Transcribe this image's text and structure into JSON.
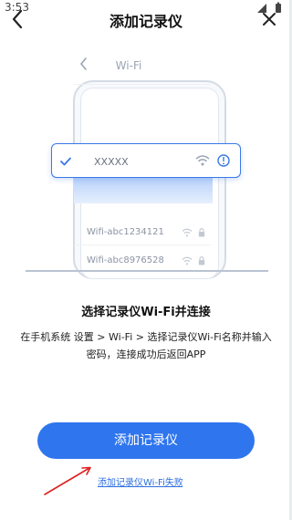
{
  "status_bar": {
    "time": "3:53"
  },
  "header": {
    "title": "添加记录仪"
  },
  "illustration": {
    "phone_title": "Wi-Fi",
    "selected_network": "XXXXX",
    "networks": [
      {
        "name": "Wifi-abc1234121"
      },
      {
        "name": "Wifi-abc8976528"
      }
    ]
  },
  "instructions": {
    "title": "选择记录仪Wi-Fi并连接",
    "body": "在手机系统 设置 > Wi-Fi > 选择记录仪Wi-Fi名称并输入密码，连接成功后返回APP"
  },
  "primary_button": {
    "label": "添加记录仪"
  },
  "fail_link": {
    "label": "添加记录仪Wi-Fi失败"
  },
  "colors": {
    "accent": "#2f75ee",
    "link": "#2f6fe0",
    "annotation_arrow": "#e02020"
  }
}
